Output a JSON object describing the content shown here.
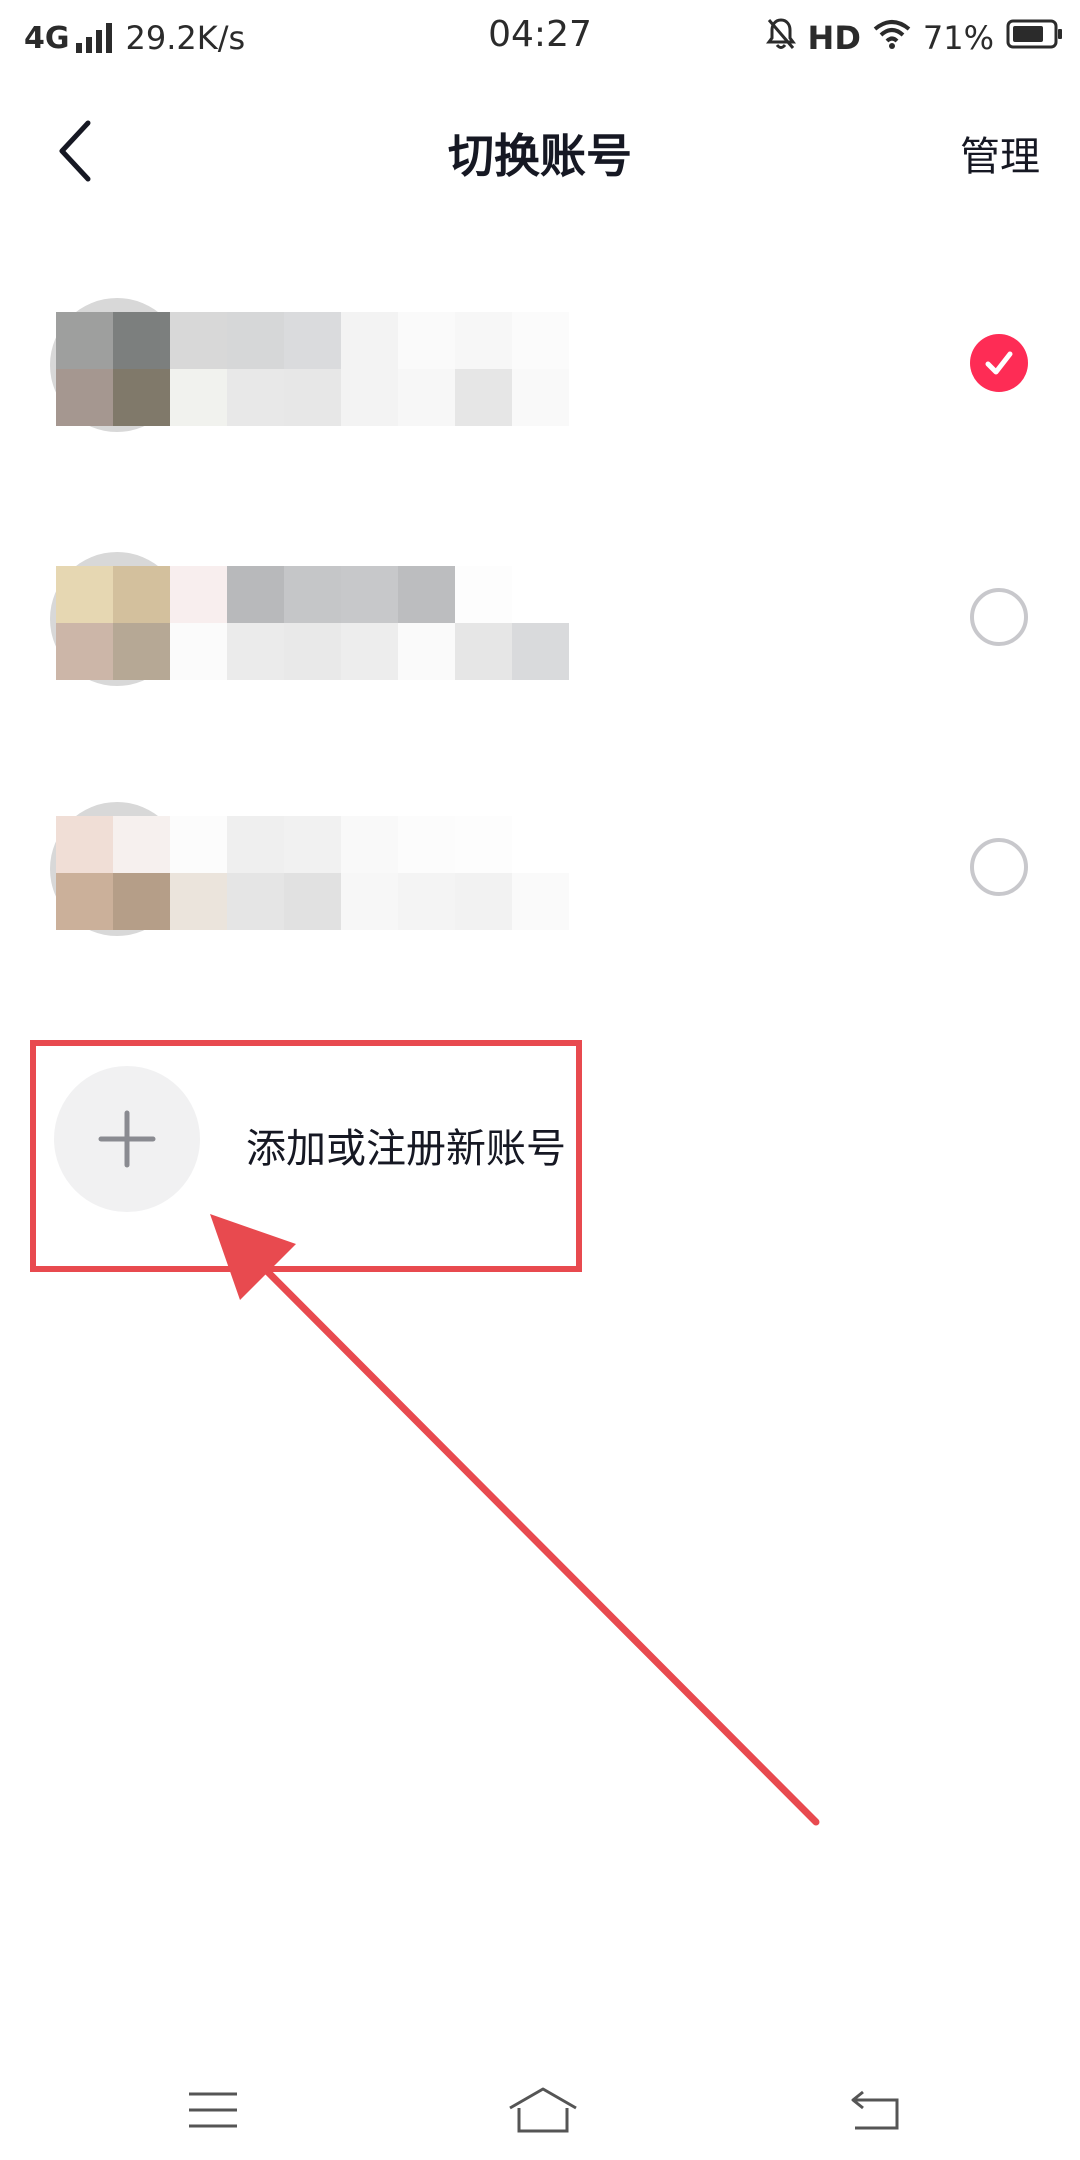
{
  "status_bar": {
    "network": "4G",
    "speed": "29.2K/s",
    "time": "04:27",
    "hd": "HD",
    "battery": "71%",
    "icons": [
      "signal-icon",
      "mute-bell-icon",
      "wifi-icon",
      "battery-icon"
    ]
  },
  "header": {
    "back_icon": "chevron-left-icon",
    "title": "切换账号",
    "manage_label": "管理"
  },
  "accounts": [
    {
      "avatar_icon": "avatar",
      "selected": true,
      "mosaic": [
        "#9e9f9e",
        "#7c7f7e",
        "#d8d8d8",
        "#d6d7d8",
        "#dadbdd",
        "#f3f3f3",
        "#fafafa",
        "#f7f7f7",
        "#fbfbfb",
        "#a59790",
        "#80796a",
        "#f1f2ee",
        "#e8e8e8",
        "#e7e7e7",
        "#f3f3f3",
        "#f7f7f7",
        "#e6e6e6",
        "#f9f9f9"
      ]
    },
    {
      "avatar_icon": "avatar",
      "selected": false,
      "mosaic": [
        "#e6d7b2",
        "#d3c09d",
        "#f8eeee",
        "#b8b9bb",
        "#c5c6c8",
        "#c7c8ca",
        "#bcbdbf",
        "#fdfdfd",
        "#ffffff",
        "#ccb6a8",
        "#b6a895",
        "#fbfbfb",
        "#ebebeb",
        "#e9e9e9",
        "#ededed",
        "#fafafa",
        "#e6e6e6",
        "#d9dadc"
      ]
    },
    {
      "avatar_icon": "avatar",
      "selected": false,
      "mosaic": [
        "#f0ded6",
        "#f6f0ee",
        "#fcfcfc",
        "#efefef",
        "#f1f1f1",
        "#f9f9f9",
        "#fcfcfc",
        "#fdfdfd",
        "#ffffff",
        "#cbb09a",
        "#b59e88",
        "#ebe4dc",
        "#e5e5e5",
        "#e1e1e1",
        "#f7f7f7",
        "#f4f4f4",
        "#f2f2f2",
        "#fafafa"
      ]
    }
  ],
  "add_account": {
    "icon": "plus-icon",
    "label": "添加或注册新账号"
  },
  "colors": {
    "accent": "#fe2c55",
    "annotation": "#e84a4f",
    "text": "#161823"
  },
  "nav_bar": {
    "icons": [
      "menu-icon",
      "home-icon",
      "back-icon"
    ]
  }
}
